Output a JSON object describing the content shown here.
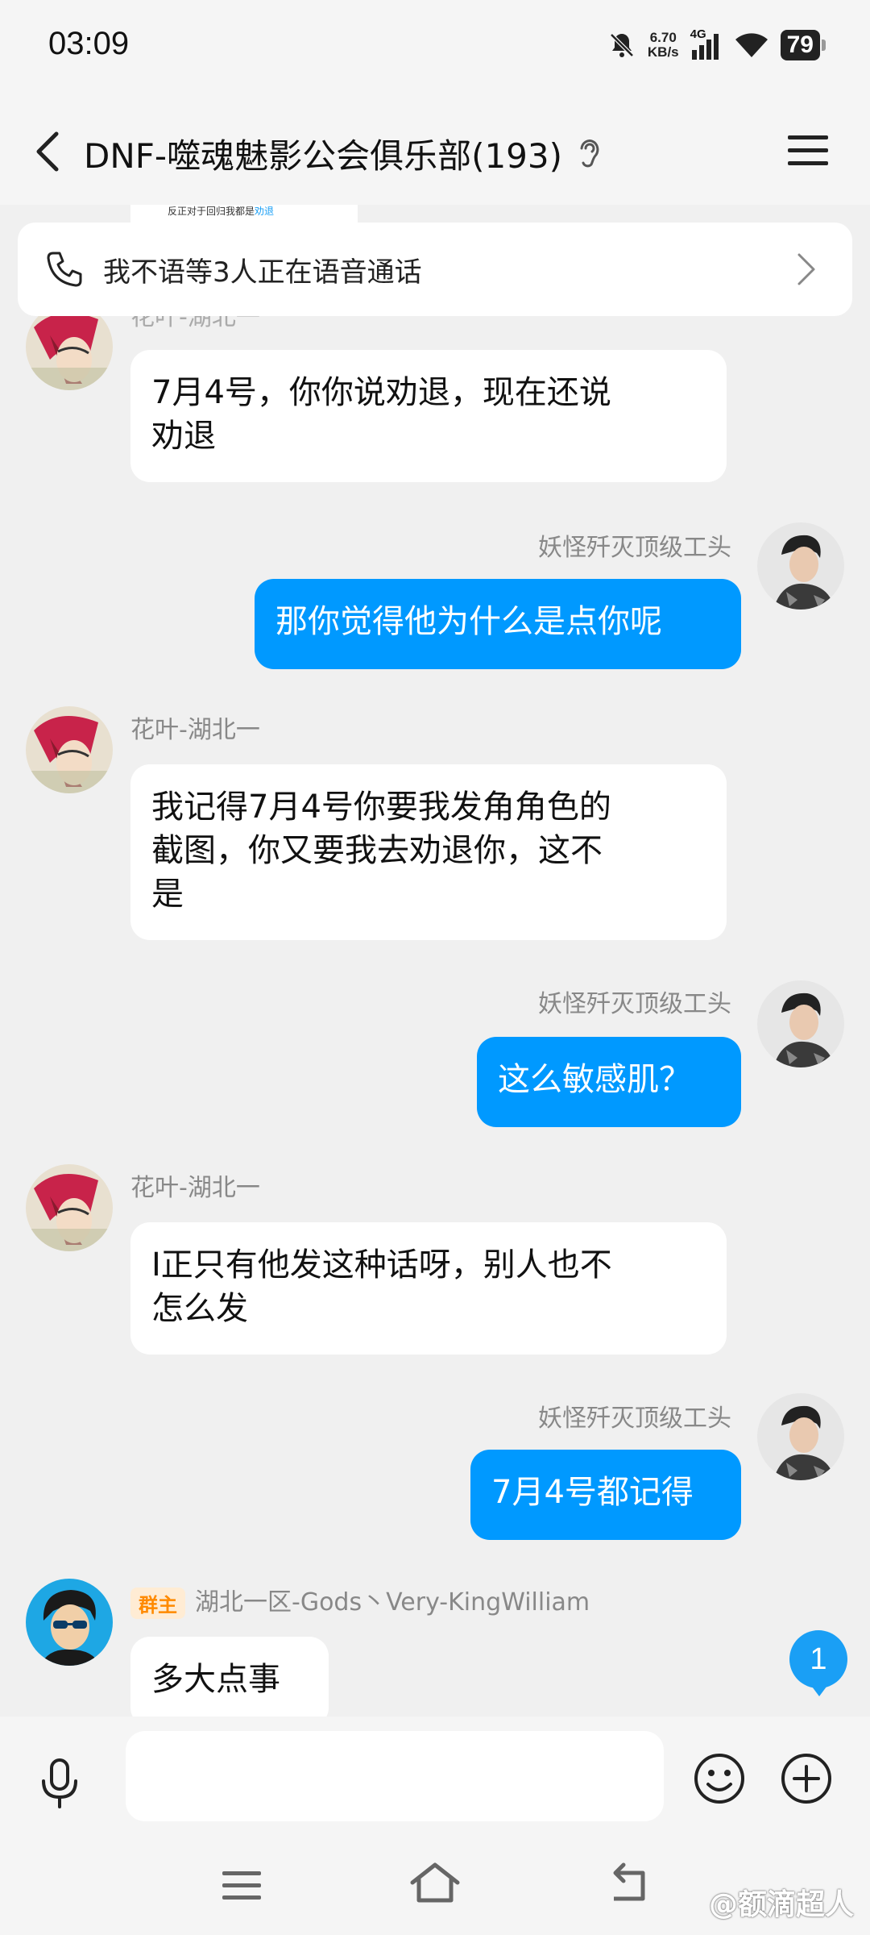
{
  "status_bar": {
    "time": "03:09",
    "net_speed_value": "6.70",
    "net_speed_unit": "KB/s",
    "network": "4G",
    "battery": "79"
  },
  "header": {
    "title": "DNF-噬魂魅影公会俱乐部(193)"
  },
  "pinned_peek": {
    "text_prefix": "反正对于回归我都是",
    "text_highlight": "劝退"
  },
  "voice_call_banner": {
    "text": "我不语等3人正在语音通话"
  },
  "messages": [
    {
      "sender": "花叶-湖北一",
      "text": "7月4号，你你说劝退，现在还说劝退",
      "line1": "7月4号，你你说劝退，现在还说",
      "line2": "劝退",
      "direction": "in"
    },
    {
      "sender": "妖怪歼灭顶级工头",
      "text": "那你觉得他为什么是点你呢",
      "direction": "out"
    },
    {
      "sender": "花叶-湖北一",
      "line1": "我记得7月4号你要我发角角色的",
      "line2": "截图，你又要我去劝退你，这不",
      "line3": "是",
      "direction": "in"
    },
    {
      "sender": "妖怪歼灭顶级工头",
      "text": "这么敏感肌？",
      "direction": "out"
    },
    {
      "sender": "花叶-湖北一",
      "line1": "I正只有他发这种话呀，别人也不",
      "line2": "怎么发",
      "direction": "in"
    },
    {
      "sender": "妖怪歼灭顶级工头",
      "text": "7月4号都记得",
      "direction": "out"
    },
    {
      "sender": "湖北一区-Gods丶Very-KingWilliam",
      "badge": "群主",
      "text": "多大点事",
      "direction": "in"
    }
  ],
  "unread_count": "1",
  "input": {
    "value": "",
    "placeholder": ""
  },
  "watermark": "@额滴超人",
  "colors": {
    "accent": "#0099ff",
    "bubble_in": "#ffffff",
    "background": "#f0f0f0"
  },
  "icons": [
    "back-icon",
    "ear-icon",
    "menu-icon",
    "phone-icon",
    "chevron-right-icon",
    "mic-icon",
    "emoji-icon",
    "plus-icon",
    "nav-menu-icon",
    "nav-home-icon",
    "nav-back-icon"
  ]
}
